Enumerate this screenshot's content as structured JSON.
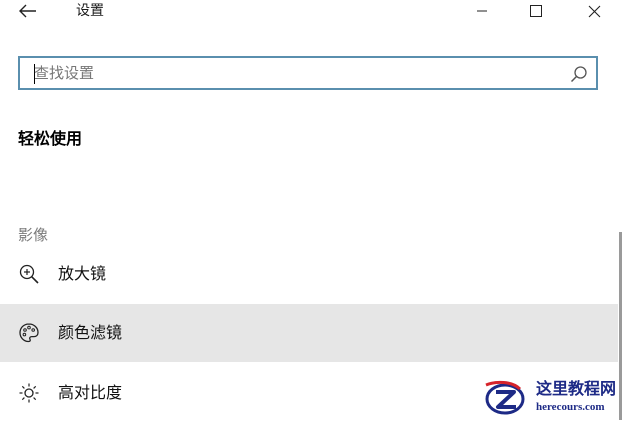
{
  "window": {
    "title": "设置"
  },
  "search": {
    "placeholder": "查找设置",
    "value": ""
  },
  "page": {
    "heading": "轻松使用"
  },
  "group": {
    "label": "影像",
    "items": [
      {
        "label": "放大镜",
        "icon": "magnifier-icon",
        "selected": false
      },
      {
        "label": "颜色滤镜",
        "icon": "palette-icon",
        "selected": true
      },
      {
        "label": "高对比度",
        "icon": "brightness-icon",
        "selected": false
      }
    ]
  },
  "watermark": {
    "title": "这里教程网",
    "url": "herecours.com"
  },
  "colors": {
    "search_border": "#5a8fae",
    "selected_bg": "#e6e6e6",
    "group_label": "#7a7a7a",
    "watermark_blue": "#1d2a86",
    "watermark_red": "#d6232a"
  }
}
